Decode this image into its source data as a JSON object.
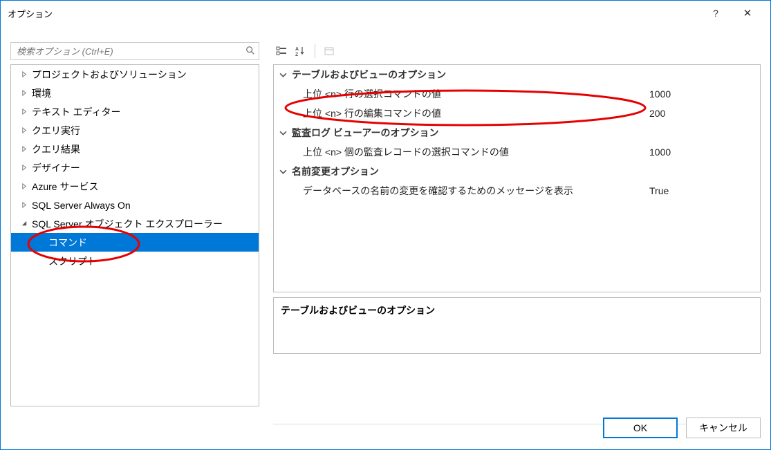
{
  "title": "オプション",
  "search": {
    "placeholder": "検索オプション (Ctrl+E)"
  },
  "tree": {
    "items": [
      {
        "label": "プロジェクトおよびソリューション",
        "expandable": true,
        "expanded": false,
        "level": 1
      },
      {
        "label": "環境",
        "expandable": true,
        "expanded": false,
        "level": 1
      },
      {
        "label": "テキスト エディター",
        "expandable": true,
        "expanded": false,
        "level": 1
      },
      {
        "label": "クエリ実行",
        "expandable": true,
        "expanded": false,
        "level": 1
      },
      {
        "label": "クエリ結果",
        "expandable": true,
        "expanded": false,
        "level": 1
      },
      {
        "label": "デザイナー",
        "expandable": true,
        "expanded": false,
        "level": 1
      },
      {
        "label": "Azure サービス",
        "expandable": true,
        "expanded": false,
        "level": 1
      },
      {
        "label": "SQL Server Always On",
        "expandable": true,
        "expanded": false,
        "level": 1
      },
      {
        "label": "SQL Server オブジェクト エクスプローラー",
        "expandable": true,
        "expanded": true,
        "level": 1
      },
      {
        "label": "コマンド",
        "expandable": false,
        "expanded": false,
        "level": 2,
        "selected": true
      },
      {
        "label": "スクリプト",
        "expandable": false,
        "expanded": false,
        "level": 2
      }
    ]
  },
  "grid": {
    "groups": [
      {
        "header": "テーブルおよびビューのオプション",
        "rows": [
          {
            "label": "上位 <n> 行の選択コマンドの値",
            "value": "1000"
          },
          {
            "label": "上位 <n> 行の編集コマンドの値",
            "value": "200"
          }
        ]
      },
      {
        "header": "監査ログ ビューアーのオプション",
        "rows": [
          {
            "label": "上位 <n> 個の監査レコードの選択コマンドの値",
            "value": "1000"
          }
        ]
      },
      {
        "header": "名前変更オプション",
        "rows": [
          {
            "label": "データベースの名前の変更を確認するためのメッセージを表示",
            "value": "True"
          }
        ]
      }
    ]
  },
  "description": {
    "title": "テーブルおよびビューのオプション"
  },
  "buttons": {
    "ok": "OK",
    "cancel": "キャンセル"
  },
  "toolbar": {
    "categorized": "categorized-icon",
    "alphabetical": "alphabetical-icon",
    "props": "property-pages-icon"
  }
}
